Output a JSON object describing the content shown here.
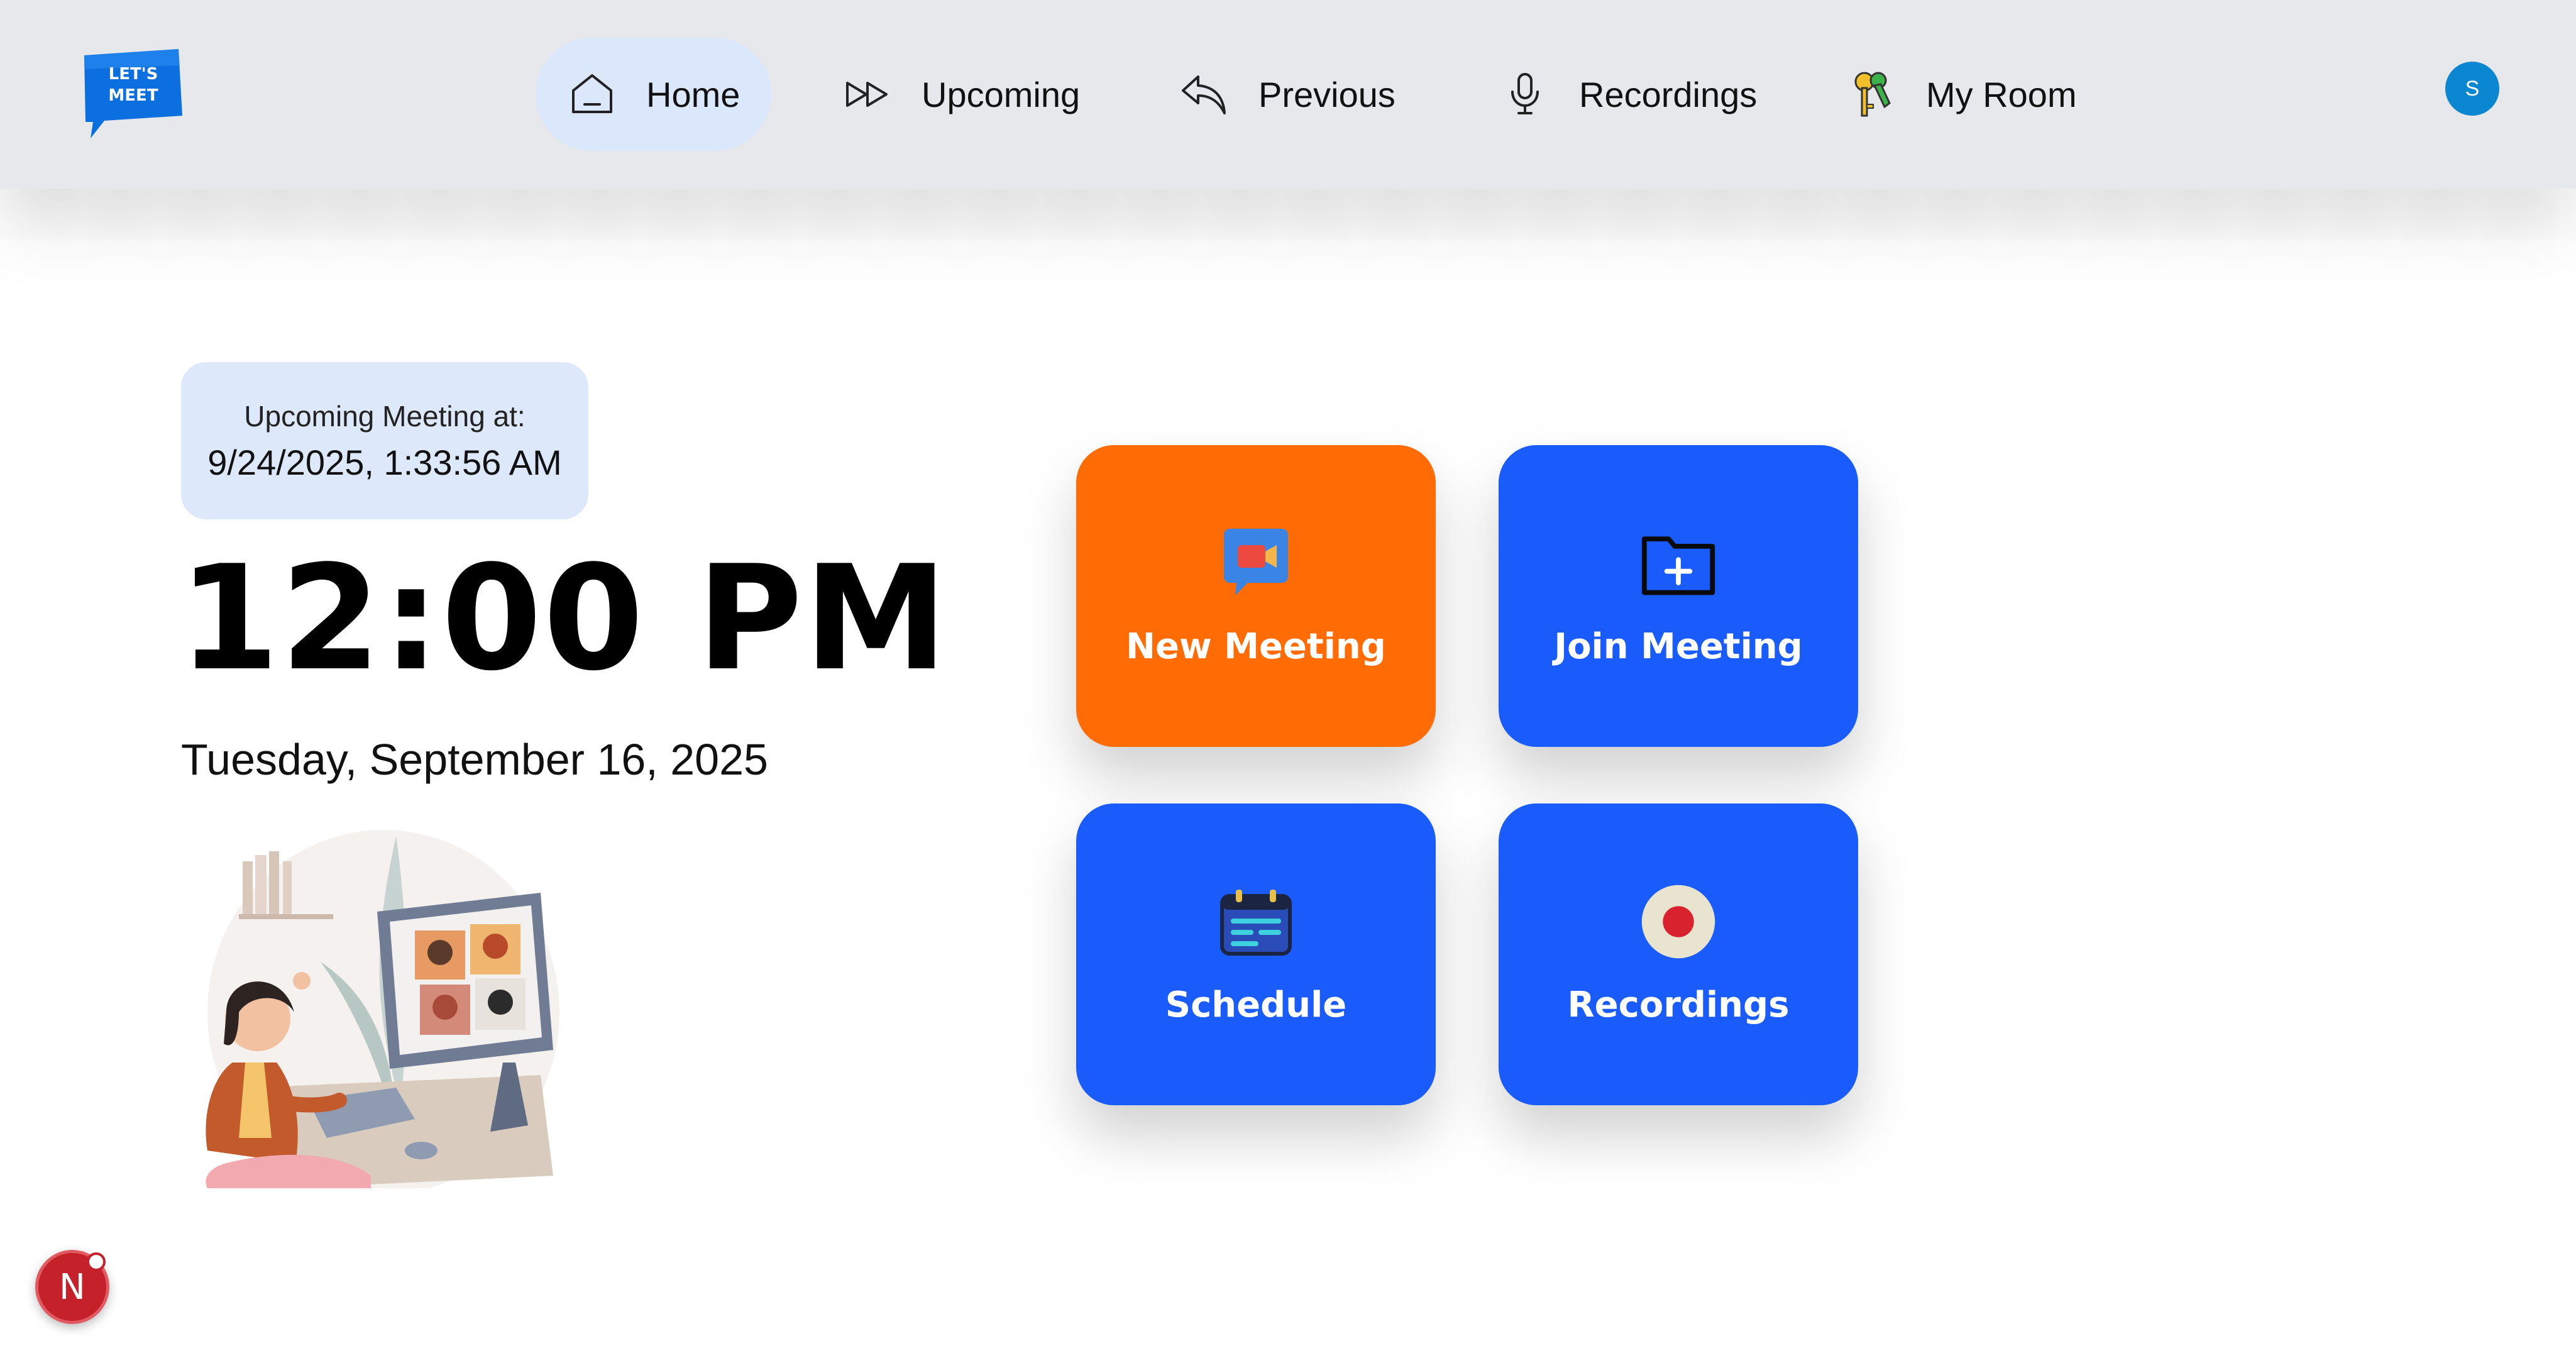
{
  "app": {
    "logo_text_line1": "LET'S",
    "logo_text_line2": "MEET",
    "brand_color": "#0b6fe0"
  },
  "nav": {
    "items": [
      {
        "label": "Home",
        "icon": "home-icon",
        "active": true
      },
      {
        "label": "Upcoming",
        "icon": "fast-forward-icon",
        "active": false
      },
      {
        "label": "Previous",
        "icon": "undo-arrow-icon",
        "active": false
      },
      {
        "label": "Recordings",
        "icon": "microphone-icon",
        "active": false
      },
      {
        "label": "My Room",
        "icon": "keys-icon",
        "active": false
      }
    ]
  },
  "user": {
    "avatar_initial": "S",
    "avatar_color": "#0b86d1"
  },
  "upcoming": {
    "label": "Upcoming Meeting at:",
    "time": "9/24/2025, 1:33:56 AM"
  },
  "clock": {
    "time": "12:00 PM",
    "date": "Tuesday, September 16, 2025"
  },
  "actions": [
    {
      "label": "New Meeting",
      "icon": "video-chat-icon",
      "color": "#ff6b04"
    },
    {
      "label": "Join Meeting",
      "icon": "folder-plus-icon",
      "color": "#1a5cfb"
    },
    {
      "label": "Schedule",
      "icon": "calendar-icon",
      "color": "#1a5cfb"
    },
    {
      "label": "Recordings",
      "icon": "record-icon",
      "color": "#1a5cfb"
    }
  ],
  "dev_badge": {
    "letter": "N",
    "color": "#c4212b"
  }
}
